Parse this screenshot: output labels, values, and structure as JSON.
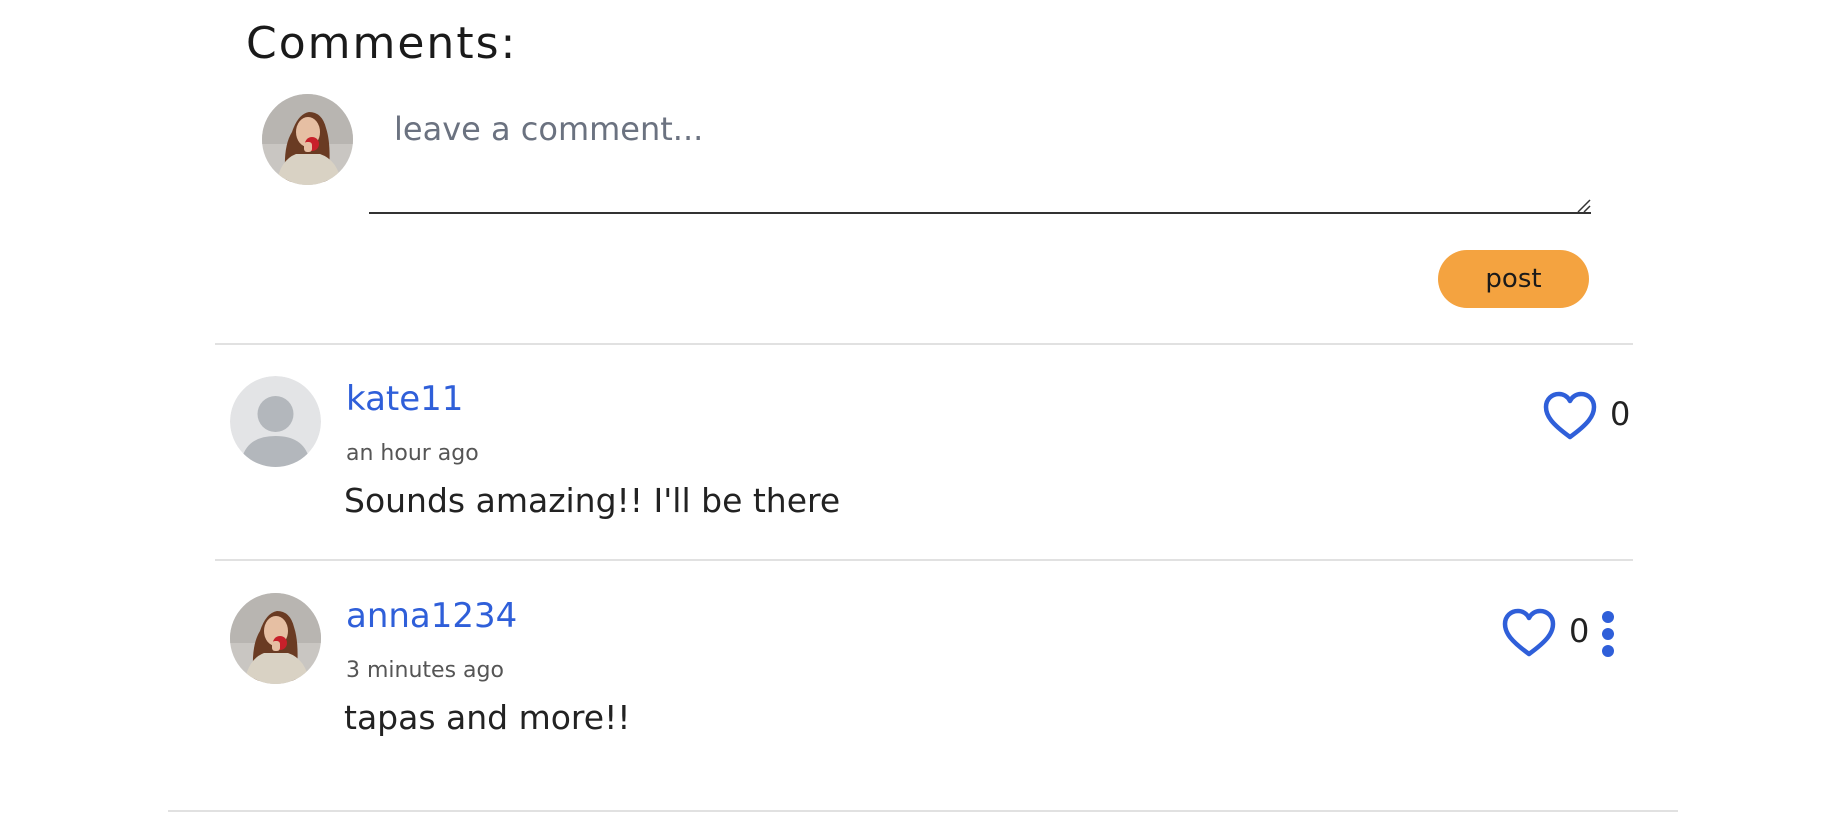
{
  "heading": "Comments:",
  "composer": {
    "placeholder": "leave a comment...",
    "value": "",
    "post_label": "post"
  },
  "comments": [
    {
      "username": "kate11",
      "time": "an hour ago",
      "text": "Sounds amazing!! I'll be there",
      "likes": "0",
      "avatar": "default-user-avatar"
    },
    {
      "username": "anna1234",
      "time": "3 minutes ago",
      "text": "tapas and more!!",
      "likes": "0",
      "avatar": "user-photo-avatar"
    }
  ],
  "colors": {
    "accent": "#2f5fd9",
    "post_button": "#f4a340",
    "divider": "#e1e1e1"
  },
  "icons": {
    "like": "heart-outline-icon",
    "more": "vertical-ellipsis-icon"
  }
}
